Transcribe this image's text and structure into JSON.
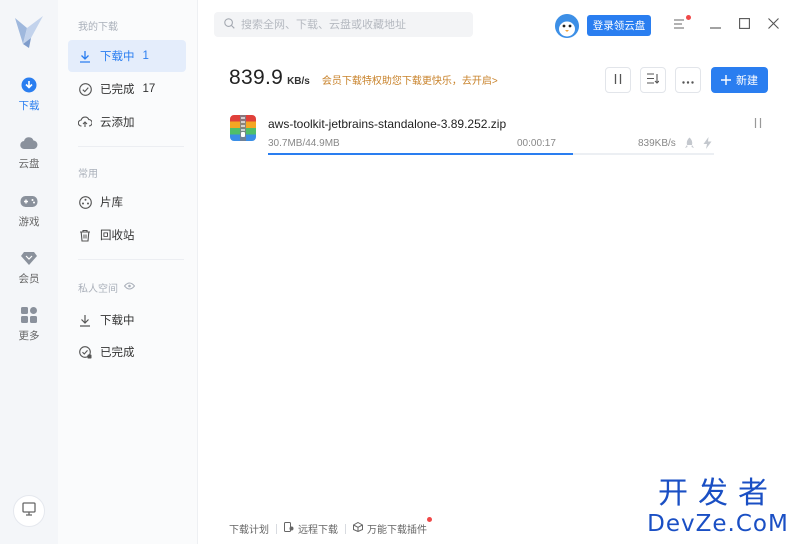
{
  "rail": {
    "items": [
      {
        "label": "下载",
        "icon": "download-circle-icon",
        "active": true
      },
      {
        "label": "云盘",
        "icon": "cloud-icon",
        "active": false
      },
      {
        "label": "游戏",
        "icon": "gamepad-icon",
        "active": false
      },
      {
        "label": "会员",
        "icon": "diamond-icon",
        "active": false
      },
      {
        "label": "更多",
        "icon": "apps-grid-icon",
        "active": false
      }
    ]
  },
  "sidebar": {
    "section_my_downloads": "我的下载",
    "downloading": {
      "label": "下载中",
      "count": "1"
    },
    "completed": {
      "label": "已完成",
      "count": "17"
    },
    "cloud_add": {
      "label": "云添加"
    },
    "section_common": "常用",
    "library": {
      "label": "片库"
    },
    "recycle": {
      "label": "回收站"
    },
    "section_private": "私人空间",
    "private_downloading": {
      "label": "下载中"
    },
    "private_completed": {
      "label": "已完成"
    }
  },
  "header": {
    "search_placeholder": "搜索全网、下载、云盘或收藏地址",
    "login_label": "登录领云盘"
  },
  "speed": {
    "value": "839.9",
    "unit": "KB/s",
    "promo": "会员下载特权助您下载更快乐，去开启>"
  },
  "toolbar": {
    "new_label": "新建"
  },
  "download": {
    "name": "aws-toolkit-jetbrains-standalone-3.89.252.zip",
    "size": "30.7MB/44.9MB",
    "time": "00:00:17",
    "rate": "839KB/s",
    "progress": 0.684
  },
  "footer": {
    "plan": "下载计划",
    "remote": "远程下载",
    "plugin": "万能下载插件"
  },
  "watermark": {
    "cn": "开发者",
    "en": "DevZe.CoM"
  },
  "colors": {
    "accent": "#2a7ef0",
    "promo": "#c8822a",
    "badge": "#f04848"
  }
}
